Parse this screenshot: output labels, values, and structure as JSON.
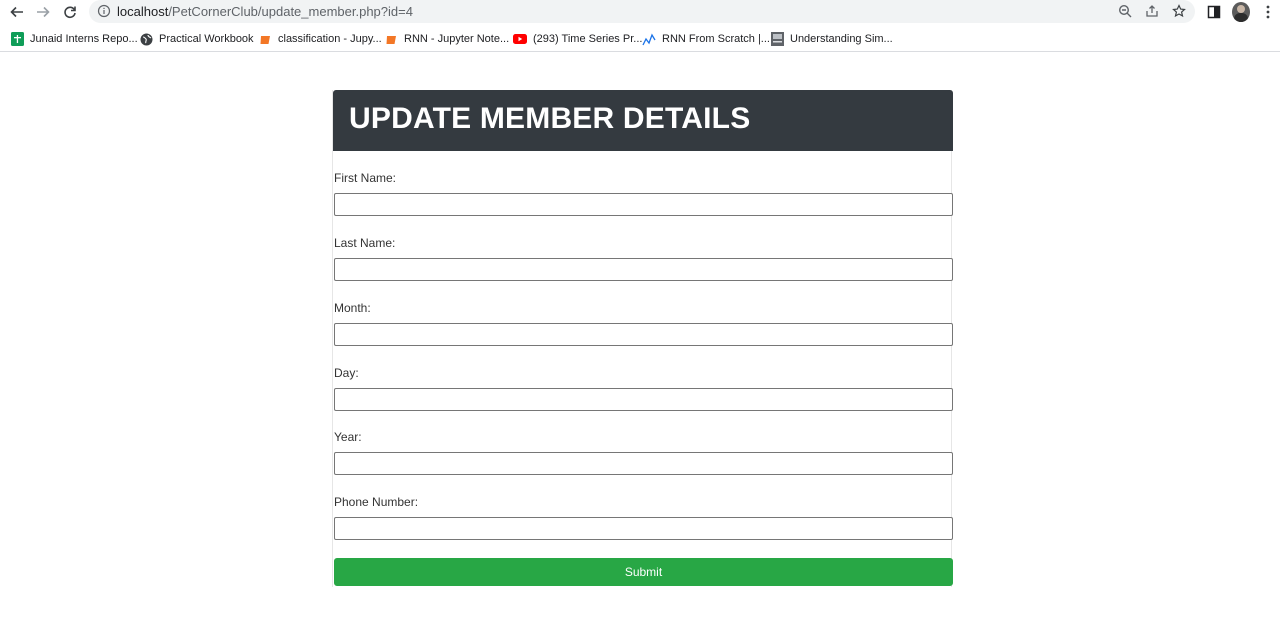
{
  "browser": {
    "url_host": "localhost",
    "url_path": "/PetCornerClub/update_member.php?id=4"
  },
  "bookmarks": [
    {
      "label": "Junaid Interns Repo...",
      "icon": "sheets-icon",
      "color": "#0f9d58"
    },
    {
      "label": "Practical Workbook",
      "icon": "globe-icon",
      "color": "#3c4043"
    },
    {
      "label": "classification - Jupy...",
      "icon": "jupyter-icon",
      "color": "#f37726"
    },
    {
      "label": "RNN - Jupyter Note...",
      "icon": "jupyter-icon",
      "color": "#f37726"
    },
    {
      "label": "(293) Time Series Pr...",
      "icon": "youtube-icon",
      "color": "#ff0000"
    },
    {
      "label": "RNN From Scratch |...",
      "icon": "chart-line-icon",
      "color": "#1a73e8"
    },
    {
      "label": "Understanding Sim...",
      "icon": "page-thumb-icon",
      "color": "#5f6368"
    }
  ],
  "form": {
    "title": "UPDATE MEMBER DETAILS",
    "fields": [
      {
        "label": "First Name:",
        "value": ""
      },
      {
        "label": "Last Name:",
        "value": ""
      },
      {
        "label": "Month:",
        "value": ""
      },
      {
        "label": "Day:",
        "value": ""
      },
      {
        "label": "Year:",
        "value": ""
      },
      {
        "label": "Phone Number:",
        "value": ""
      }
    ],
    "submit_label": "Submit"
  },
  "colors": {
    "header_bg": "#343a40",
    "submit_bg": "#28a745"
  }
}
